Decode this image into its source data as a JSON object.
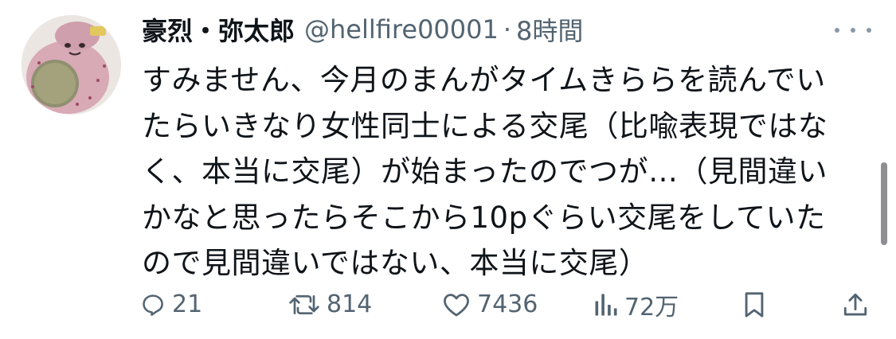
{
  "tweet": {
    "display_name": "豪烈・弥太郎",
    "handle": "@hellfire00001",
    "separator": "·",
    "time": "8時間",
    "text": "すみません、今月のまんがタイムきららを読んでいたらいきなり女性同士による交尾（比喩表現ではなく、本当に交尾）が始まったのでつが…（見間違いかなと思ったらそこから10pぐらい交尾をしていたので見間違いではない、本当に交尾）"
  },
  "actions": {
    "reply_count": "21",
    "retweet_count": "814",
    "like_count": "7436",
    "views_count": "72万"
  },
  "icons": {
    "more": "more-horizontal-icon",
    "reply": "reply-icon",
    "retweet": "retweet-icon",
    "like": "heart-icon",
    "views": "views-icon",
    "bookmark": "bookmark-icon",
    "share": "share-icon"
  },
  "colors": {
    "text": "#0f1419",
    "secondary": "#536471"
  }
}
